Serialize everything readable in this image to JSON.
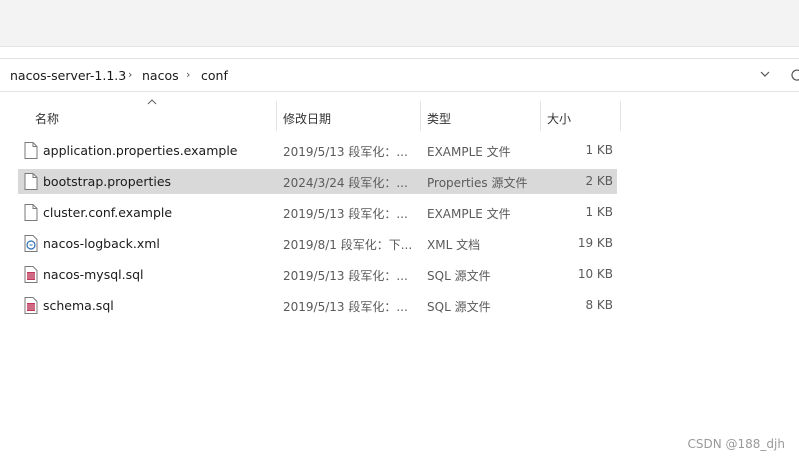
{
  "breadcrumb": {
    "items": [
      "nacos-server-1.1.3",
      "nacos",
      "conf"
    ],
    "separator": "›"
  },
  "columns": {
    "name": "名称",
    "modified": "修改日期",
    "type": "类型",
    "size": "大小"
  },
  "files": [
    {
      "name": "application.properties.example",
      "modified": "2019/5/13 段军化：...",
      "type": "EXAMPLE 文件",
      "size": "1 KB",
      "icon": "blank-file-icon",
      "selected": false
    },
    {
      "name": "bootstrap.properties",
      "modified": "2024/3/24 段军化：...",
      "type": "Properties 源文件",
      "size": "2 KB",
      "icon": "blank-file-icon",
      "selected": true
    },
    {
      "name": "cluster.conf.example",
      "modified": "2019/5/13 段军化：...",
      "type": "EXAMPLE 文件",
      "size": "1 KB",
      "icon": "blank-file-icon",
      "selected": false
    },
    {
      "name": "nacos-logback.xml",
      "modified": "2019/8/1 段军化：下...",
      "type": "XML 文档",
      "size": "19 KB",
      "icon": "xml-file-icon",
      "selected": false
    },
    {
      "name": "nacos-mysql.sql",
      "modified": "2019/5/13 段军化：...",
      "type": "SQL 源文件",
      "size": "10 KB",
      "icon": "sql-file-icon",
      "selected": false
    },
    {
      "name": "schema.sql",
      "modified": "2019/5/13 段军化：...",
      "type": "SQL 源文件",
      "size": "8 KB",
      "icon": "sql-file-icon",
      "selected": false
    }
  ],
  "watermark": "CSDN @188_djh",
  "colors": {
    "selected_row": "#d9d9d9",
    "sql_icon_accent": "#c0395b",
    "xml_icon_accent": "#2d6fb3"
  }
}
